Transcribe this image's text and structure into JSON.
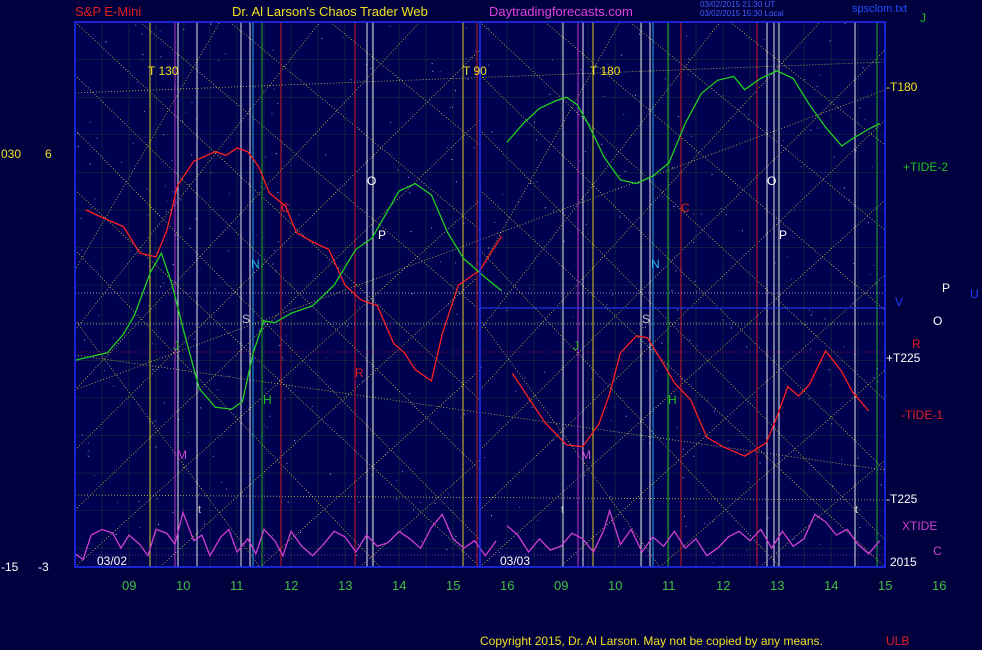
{
  "header": {
    "instrument": "S&P E-Mini",
    "site_title": "Dr. Al Larson's Chaos Trader Web",
    "site_url": "Daytradingforecasts.com",
    "timestamp_line1": "03/02/2015 21:30 UT",
    "timestamp_line2": "03/02/2015 15:30 Local",
    "file_name": "spsclom.txt"
  },
  "footer": {
    "copyright": "Copyright 2015, Dr. Al Larson. May not be copied by any means.",
    "corner": "ULB"
  },
  "left_scale": {
    "top_outer": "030",
    "top_inner": "6",
    "bottom_outer": "-15",
    "bottom_inner": "-3"
  },
  "right_labels": {
    "j": "J",
    "t180": "-T180",
    "tide2": "+TIDE-2",
    "v": "V",
    "p": "P",
    "u": "U",
    "o": "O",
    "r": "R",
    "t225_pos": "+T225",
    "tide1": "-TIDE-1",
    "t225_neg": "-T225",
    "xtide": "XTIDE",
    "year": "2015",
    "c": "C"
  },
  "session_dates": [
    "03/02",
    "03/03"
  ],
  "hour_ticks": [
    "09",
    "10",
    "11",
    "12",
    "13",
    "14",
    "15",
    "16",
    "09",
    "10",
    "11",
    "12",
    "13",
    "14",
    "15",
    "16"
  ],
  "chart_labels": {
    "t130": "T  130",
    "t90": "T  90",
    "t180": "T  180",
    "c": "C",
    "o": "O",
    "p": "P",
    "n": "N",
    "s": "S",
    "j": "J",
    "h": "H",
    "r": "R",
    "m": "M",
    "t": "t"
  },
  "colors": {
    "background": "#00003f",
    "plot_bg": "#000050",
    "grid": "#2a6a2a",
    "price": "#ff2020",
    "tide2": "#20d020",
    "xtide": "#d040d0",
    "sun_lines": "#e8e840",
    "hour_text": "#40c040",
    "header_red": "#e02020",
    "header_yellow": "#f0e020",
    "header_magenta": "#e040e0"
  },
  "chart_data": {
    "type": "line",
    "x_sessions": [
      "03/02",
      "03/03"
    ],
    "x_hours": [
      "09",
      "10",
      "11",
      "12",
      "13",
      "14",
      "15",
      "16"
    ],
    "series": [
      {
        "name": "S&P E-Mini",
        "color": "#ff2020",
        "points": [
          [
            8.2,
            2.0
          ],
          [
            8.5,
            1.6
          ],
          [
            8.9,
            1.1
          ],
          [
            9.2,
            -0.3
          ],
          [
            9.5,
            -0.5
          ],
          [
            9.7,
            0.9
          ],
          [
            9.9,
            3.3
          ],
          [
            10.2,
            4.6
          ],
          [
            10.6,
            5.1
          ],
          [
            10.8,
            4.9
          ],
          [
            11.0,
            5.3
          ],
          [
            11.2,
            5.1
          ],
          [
            11.4,
            4.3
          ],
          [
            11.6,
            2.9
          ],
          [
            11.9,
            2.2
          ],
          [
            12.1,
            0.8
          ],
          [
            12.4,
            0.3
          ],
          [
            12.7,
            -0.1
          ],
          [
            13.0,
            -2.0
          ],
          [
            13.3,
            -2.8
          ],
          [
            13.6,
            -3.1
          ],
          [
            13.9,
            -5.1
          ],
          [
            14.1,
            -5.6
          ],
          [
            14.3,
            -6.5
          ],
          [
            14.6,
            -7.1
          ],
          [
            14.8,
            -4.6
          ],
          [
            15.1,
            -2.0
          ],
          [
            15.5,
            -1.2
          ],
          [
            15.9,
            0.6
          ],
          [
            16.1,
            -6.7
          ],
          [
            16.4,
            -8.0
          ],
          [
            16.7,
            -9.3
          ],
          [
            17.1,
            -10.5
          ],
          [
            17.4,
            -10.6
          ],
          [
            17.7,
            -9.4
          ],
          [
            17.9,
            -7.8
          ],
          [
            18.1,
            -5.6
          ],
          [
            18.4,
            -4.7
          ],
          [
            18.6,
            -4.8
          ],
          [
            18.9,
            -6.2
          ],
          [
            19.1,
            -7.2
          ],
          [
            19.4,
            -8.1
          ],
          [
            19.7,
            -10.1
          ],
          [
            20.0,
            -10.6
          ],
          [
            20.4,
            -11.1
          ],
          [
            20.8,
            -10.4
          ],
          [
            21.0,
            -9.0
          ],
          [
            21.2,
            -7.4
          ],
          [
            21.4,
            -7.9
          ],
          [
            21.6,
            -7.3
          ],
          [
            21.9,
            -5.5
          ],
          [
            22.2,
            -6.6
          ],
          [
            22.4,
            -7.7
          ],
          [
            22.7,
            -8.7
          ]
        ]
      },
      {
        "name": "+TIDE-2",
        "color": "#20d020",
        "points": [
          [
            8.0,
            -6.0
          ],
          [
            8.3,
            -5.8
          ],
          [
            8.6,
            -5.6
          ],
          [
            8.9,
            -4.6
          ],
          [
            9.1,
            -3.6
          ],
          [
            9.4,
            -1.3
          ],
          [
            9.6,
            -0.3
          ],
          [
            9.8,
            -2.0
          ],
          [
            10.0,
            -4.3
          ],
          [
            10.3,
            -7.5
          ],
          [
            10.6,
            -8.5
          ],
          [
            10.9,
            -8.6
          ],
          [
            11.1,
            -8.2
          ],
          [
            11.3,
            -5.6
          ],
          [
            11.5,
            -3.9
          ],
          [
            11.7,
            -4.0
          ],
          [
            12.0,
            -3.5
          ],
          [
            12.4,
            -3.1
          ],
          [
            12.8,
            -2.0
          ],
          [
            13.2,
            -0.1
          ],
          [
            13.5,
            0.5
          ],
          [
            13.8,
            2.0
          ],
          [
            14.0,
            3.0
          ],
          [
            14.3,
            3.4
          ],
          [
            14.6,
            2.8
          ],
          [
            14.9,
            0.8
          ],
          [
            15.2,
            -0.6
          ],
          [
            15.6,
            -1.6
          ],
          [
            15.9,
            -2.3
          ],
          [
            16.0,
            5.6
          ],
          [
            16.3,
            6.6
          ],
          [
            16.6,
            7.4
          ],
          [
            16.9,
            7.8
          ],
          [
            17.1,
            8.0
          ],
          [
            17.3,
            7.6
          ],
          [
            17.5,
            6.6
          ],
          [
            17.8,
            4.8
          ],
          [
            18.1,
            3.6
          ],
          [
            18.4,
            3.4
          ],
          [
            18.7,
            3.8
          ],
          [
            19.0,
            4.5
          ],
          [
            19.3,
            6.6
          ],
          [
            19.6,
            8.2
          ],
          [
            19.9,
            8.9
          ],
          [
            20.2,
            9.1
          ],
          [
            20.4,
            8.4
          ],
          [
            20.7,
            9.0
          ],
          [
            21.0,
            9.4
          ],
          [
            21.3,
            9.0
          ],
          [
            21.6,
            7.6
          ],
          [
            21.9,
            6.4
          ],
          [
            22.2,
            5.4
          ],
          [
            22.4,
            5.8
          ],
          [
            22.7,
            6.3
          ],
          [
            22.9,
            6.6
          ]
        ]
      },
      {
        "name": "XTIDE",
        "color": "#d040d0",
        "points": [
          [
            8.0,
            -16.3
          ],
          [
            8.15,
            -16.6
          ],
          [
            8.3,
            -15.3
          ],
          [
            8.5,
            -15.0
          ],
          [
            8.7,
            -15.2
          ],
          [
            8.85,
            -16.0
          ],
          [
            9.0,
            -15.3
          ],
          [
            9.2,
            -15.8
          ],
          [
            9.35,
            -16.4
          ],
          [
            9.5,
            -15.0
          ],
          [
            9.7,
            -15.2
          ],
          [
            9.85,
            -15.8
          ],
          [
            10.0,
            -14.1
          ],
          [
            10.2,
            -15.6
          ],
          [
            10.35,
            -15.3
          ],
          [
            10.5,
            -16.4
          ],
          [
            10.7,
            -15.4
          ],
          [
            10.85,
            -15.0
          ],
          [
            11.0,
            -16.2
          ],
          [
            11.2,
            -15.5
          ],
          [
            11.35,
            -16.3
          ],
          [
            11.5,
            -15.0
          ],
          [
            11.7,
            -15.6
          ],
          [
            11.85,
            -16.4
          ],
          [
            12.0,
            -15.1
          ],
          [
            12.2,
            -15.9
          ],
          [
            12.4,
            -16.4
          ],
          [
            12.6,
            -15.8
          ],
          [
            12.8,
            -15.1
          ],
          [
            13.0,
            -15.4
          ],
          [
            13.2,
            -16.2
          ],
          [
            13.4,
            -15.3
          ],
          [
            13.6,
            -15.9
          ],
          [
            13.8,
            -15.7
          ],
          [
            14.0,
            -15.1
          ],
          [
            14.2,
            -15.5
          ],
          [
            14.4,
            -16.0
          ],
          [
            14.6,
            -14.9
          ],
          [
            14.8,
            -14.2
          ],
          [
            15.0,
            -15.5
          ],
          [
            15.2,
            -16.0
          ],
          [
            15.4,
            -15.6
          ],
          [
            15.6,
            -16.4
          ],
          [
            15.8,
            -15.6
          ],
          [
            16.0,
            -14.8
          ],
          [
            16.2,
            -15.3
          ],
          [
            16.4,
            -16.2
          ],
          [
            16.6,
            -15.5
          ],
          [
            16.8,
            -16.1
          ],
          [
            17.0,
            -15.9
          ],
          [
            17.2,
            -15.2
          ],
          [
            17.4,
            -15.5
          ],
          [
            17.6,
            -16.2
          ],
          [
            17.8,
            -15.0
          ],
          [
            17.9,
            -14.0
          ],
          [
            18.1,
            -15.8
          ],
          [
            18.3,
            -15.0
          ],
          [
            18.5,
            -16.2
          ],
          [
            18.7,
            -15.4
          ],
          [
            18.9,
            -15.9
          ],
          [
            19.1,
            -15.1
          ],
          [
            19.3,
            -16.0
          ],
          [
            19.5,
            -15.5
          ],
          [
            19.7,
            -16.4
          ],
          [
            19.9,
            -16.0
          ],
          [
            20.1,
            -15.4
          ],
          [
            20.3,
            -15.1
          ],
          [
            20.5,
            -15.6
          ],
          [
            20.7,
            -15.0
          ],
          [
            20.9,
            -16.0
          ],
          [
            21.1,
            -15.1
          ],
          [
            21.3,
            -15.9
          ],
          [
            21.5,
            -15.5
          ],
          [
            21.7,
            -14.2
          ],
          [
            21.9,
            -14.6
          ],
          [
            22.1,
            -15.3
          ],
          [
            22.3,
            -15.0
          ],
          [
            22.5,
            -15.8
          ],
          [
            22.7,
            -16.3
          ],
          [
            22.9,
            -15.6
          ]
        ]
      }
    ],
    "ylim": [
      -17,
      12
    ],
    "grid": true
  }
}
